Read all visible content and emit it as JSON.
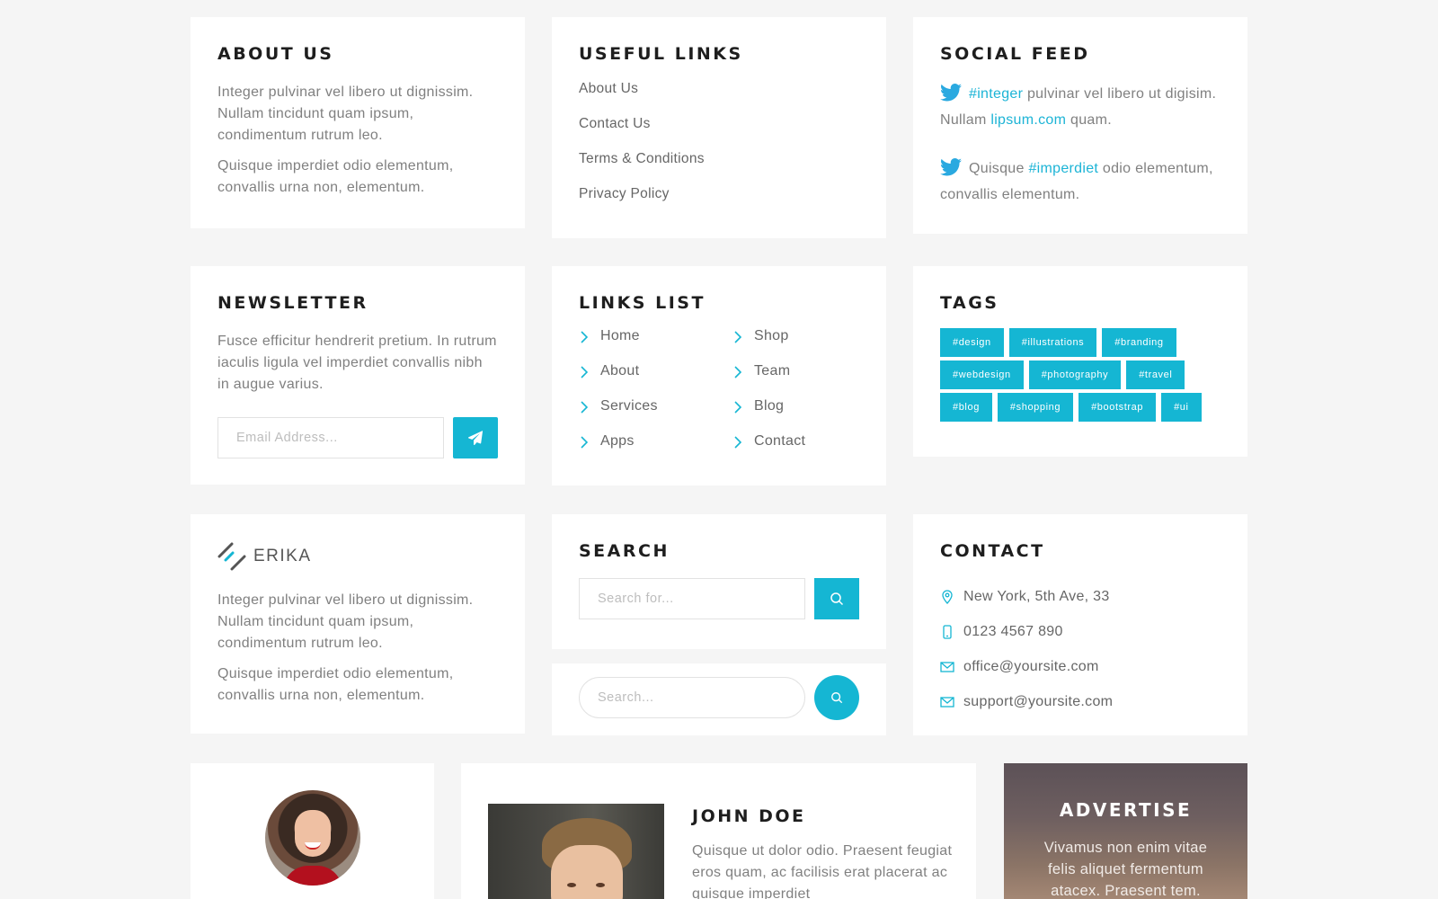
{
  "about": {
    "title": "ABOUT US",
    "p1": "Integer pulvinar vel libero ut dignissim. Nullam tincidunt quam ipsum, condimentum rutrum leo.",
    "p2": "Quisque imperdiet odio elementum, convallis urna non, elementum."
  },
  "useful_links": {
    "title": "USEFUL LINKS",
    "items": [
      "About Us",
      "Contact Us",
      "Terms & Conditions",
      "Privacy Policy"
    ]
  },
  "social_feed": {
    "title": "SOCIAL FEED",
    "tweets": [
      {
        "tag": "#integer",
        "text1": " pulvinar vel libero ut digisim. Nullam ",
        "link": "lipsum.com",
        "text2": " quam."
      },
      {
        "pre": "Quisque ",
        "tag": "#imperdiet",
        "text1": " odio elementum, convallis elementum."
      }
    ],
    "icon": "twitter-icon"
  },
  "newsletter": {
    "title": "NEWSLETTER",
    "text": "Fusce efficitur hendrerit pretium. In rutrum iaculis ligula vel imperdiet convallis nibh in augue varius.",
    "placeholder": "Email Address...",
    "button_icon": "paper-plane-icon"
  },
  "links_list": {
    "title": "LINKS LIST",
    "col1": [
      "Home",
      "About",
      "Services",
      "Apps"
    ],
    "col2": [
      "Shop",
      "Team",
      "Blog",
      "Contact"
    ]
  },
  "tags": {
    "title": "TAGS",
    "items": [
      "#design",
      "#illustrations",
      "#branding",
      "#webdesign",
      "#photography",
      "#travel",
      "#blog",
      "#shopping",
      "#bootstrap",
      "#ui"
    ]
  },
  "brand": {
    "name": "ERIKA",
    "p1": "Integer pulvinar vel libero ut dignissim. Nullam tincidunt quam ipsum, condimentum rutrum leo.",
    "p2": "Quisque imperdiet odio elementum, convallis urna non, elementum."
  },
  "search": {
    "title": "SEARCH",
    "placeholder1": "Search for...",
    "placeholder2": "Search..."
  },
  "contact": {
    "title": "CONTACT",
    "address": "New York, 5th Ave, 33",
    "phone": "0123 4567 890",
    "email1": "office@yoursite.com",
    "email2": "support@yoursite.com"
  },
  "profile_card": {
    "name": "JOHN DOE",
    "text": "Quisque ut dolor odio. Praesent feugiat eros quam, ac facilisis erat placerat ac quisque imperdiet"
  },
  "advertise": {
    "title": "ADVERTISE",
    "text": "Vivamus non enim vitae felis aliquet fermentum atacex. Praesent tem."
  },
  "colors": {
    "accent": "#15b6d3",
    "background": "#f5f5f5",
    "card": "#ffffff",
    "heading": "#1e1e1e"
  }
}
